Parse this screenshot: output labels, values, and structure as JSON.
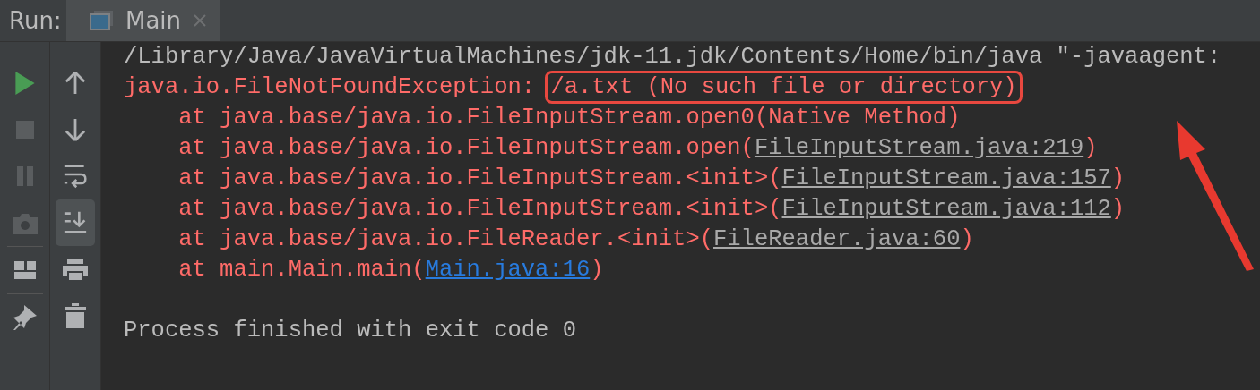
{
  "run_bar": {
    "label": "Run:",
    "tabs": [
      {
        "title": "Main",
        "selected": true
      }
    ]
  },
  "toolbar_left": [
    {
      "kind": "run",
      "disabled": false
    },
    {
      "kind": "stop",
      "disabled": true
    },
    {
      "kind": "pause",
      "disabled": true
    },
    {
      "kind": "camera",
      "disabled": true
    },
    {
      "kind": "separator"
    },
    {
      "kind": "layout",
      "disabled": false
    },
    {
      "kind": "separator"
    },
    {
      "kind": "pin",
      "disabled": false
    }
  ],
  "toolbar_right": [
    {
      "kind": "up",
      "selected": false
    },
    {
      "kind": "down",
      "selected": false
    },
    {
      "kind": "wrap",
      "selected": false
    },
    {
      "kind": "scroll-end",
      "selected": true
    },
    {
      "kind": "print",
      "selected": false
    },
    {
      "kind": "trash",
      "selected": false
    }
  ],
  "console": {
    "lines": [
      [
        {
          "kind": "plain",
          "text": "/Library/Java/JavaVirtualMachines/jdk-11.jdk/Contents/Home/bin/java \"-javaagent:"
        }
      ],
      [
        {
          "kind": "error",
          "text": "java.io.FileNotFoundException: "
        },
        {
          "kind": "highlighted",
          "text": "/a.txt (No such file or directory)"
        }
      ],
      [
        {
          "kind": "error",
          "text": "    at java.base/java.io.FileInputStream.open0(Native Method)"
        }
      ],
      [
        {
          "kind": "error",
          "text": "    at java.base/java.io.FileInputStream.open("
        },
        {
          "kind": "link",
          "text": "FileInputStream.java:219"
        },
        {
          "kind": "error",
          "text": ")"
        }
      ],
      [
        {
          "kind": "error",
          "text": "    at java.base/java.io.FileInputStream.<init>("
        },
        {
          "kind": "link",
          "text": "FileInputStream.java:157"
        },
        {
          "kind": "error",
          "text": ")"
        }
      ],
      [
        {
          "kind": "error",
          "text": "    at java.base/java.io.FileInputStream.<init>("
        },
        {
          "kind": "link",
          "text": "FileInputStream.java:112"
        },
        {
          "kind": "error",
          "text": ")"
        }
      ],
      [
        {
          "kind": "error",
          "text": "    at java.base/java.io.FileReader.<init>("
        },
        {
          "kind": "link",
          "text": "FileReader.java:60"
        },
        {
          "kind": "error",
          "text": ")"
        }
      ],
      [
        {
          "kind": "error",
          "text": "    at main.Main.main("
        },
        {
          "kind": "link-blue",
          "text": "Main.java:16"
        },
        {
          "kind": "error",
          "text": ")"
        }
      ]
    ],
    "exit_message": "Process finished with exit code 0"
  }
}
